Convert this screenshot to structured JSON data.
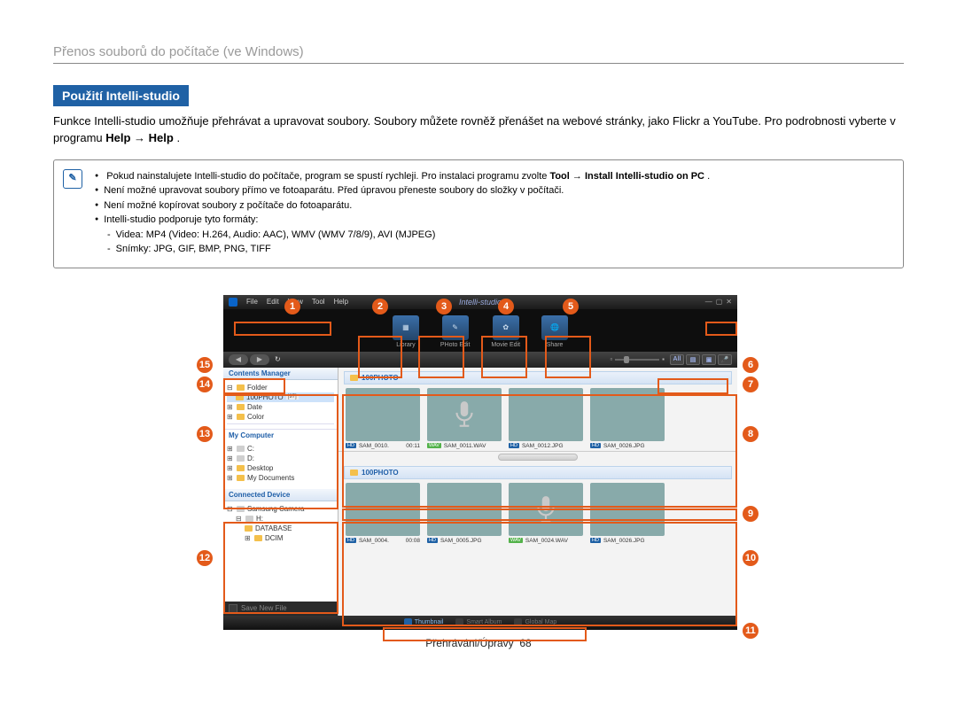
{
  "header": "Přenos souborů do počítače (ve Windows)",
  "section_title": "Použití Intelli-studio",
  "intro_1": "Funkce Intelli-studio umožňuje přehrávat a upravovat soubory. Soubory můžete rovněž přenášet na webové stránky, jako Flickr a YouTube. Pro podrobnosti vyberte v programu ",
  "intro_bold1": "Help",
  "intro_arrow": " → ",
  "intro_bold2": "Help",
  "intro_dot": ".",
  "notes": {
    "n1a": "Pokud nainstalujete Intelli-studio do počítače, program se spustí rychleji. Pro instalaci programu zvolte ",
    "n1b": "Tool → Install Intelli-studio on PC",
    "n1c": ".",
    "n2": "Není možné upravovat soubory přímo ve fotoaparátu. Před úpravou přeneste soubory do složky v počítači.",
    "n3": "Není možné kopírovat soubory z počítače do fotoaparátu.",
    "n4": "Intelli-studio podporuje tyto formáty:",
    "n4a": "Videa: MP4 (Video: H.264, Audio: AAC), WMV (WMV 7/8/9), AVI (MJPEG)",
    "n4b": "Snímky: JPG, GIF, BMP, PNG, TIFF"
  },
  "menus": {
    "file": "File",
    "edit": "Edit",
    "view": "View",
    "tool": "Tool",
    "help": "Help"
  },
  "brand": "Intelli-studio",
  "modes": {
    "library": "Library",
    "photo": "PHoto Edit",
    "movie": "Movie Edit",
    "share": "Share"
  },
  "filter_all": "All",
  "sidebar": {
    "contents": "Contents Manager",
    "folder": "Folder",
    "photo100": "100PHOTO",
    "tag97": "[97]",
    "date": "Date",
    "color": "Color",
    "mycomputer": "My Computer",
    "c": "C:",
    "d": "D:",
    "desktop": "Desktop",
    "mydocs": "My Documents",
    "connected": "Connected Device",
    "samsung": "Samsung Camera",
    "h": "H:",
    "database": "DATABASE",
    "dcim": "DCIM",
    "save": "Save New File"
  },
  "grid_hd": "100PHOTO",
  "thumbs_top": [
    {
      "badge": "HD",
      "name": "SAM_0010.",
      "time": "00:11",
      "cls": "t-a"
    },
    {
      "badge": "WAV",
      "name": "SAM_0011.WAV",
      "cls": "mic"
    },
    {
      "badge": "HD",
      "name": "SAM_0012.JPG",
      "cls": "t-b"
    },
    {
      "badge": "HD",
      "name": "SAM_0026.JPG",
      "cls": "t-c"
    }
  ],
  "thumbs_bot": [
    {
      "badge": "HD",
      "name": "SAM_0004.",
      "time": "00:08",
      "cls": "t-d"
    },
    {
      "badge": "HD",
      "name": "SAM_0005.JPG",
      "cls": "t-e"
    },
    {
      "badge": "WAV",
      "name": "SAM_0024.WAV",
      "cls": "mic"
    },
    {
      "badge": "HD",
      "name": "SAM_0026.JPG",
      "cls": "t-f"
    }
  ],
  "bottom": {
    "thumb": "Thumbnail",
    "smart": "Smart Album",
    "map": "Global Map"
  },
  "callouts": [
    "1",
    "2",
    "3",
    "4",
    "5",
    "6",
    "7",
    "8",
    "9",
    "10",
    "11",
    "12",
    "13",
    "14",
    "15"
  ],
  "footer_a": "Přehráváni/Úpravy",
  "footer_b": "68"
}
